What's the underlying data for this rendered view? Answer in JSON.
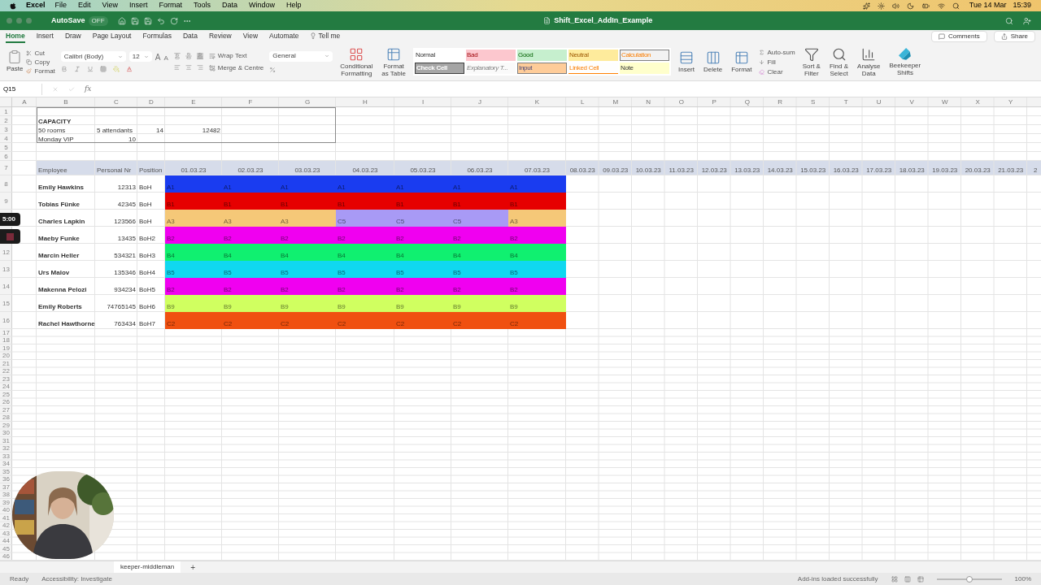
{
  "menu_bar": {
    "app": "Excel",
    "items": [
      "File",
      "Edit",
      "View",
      "Insert",
      "Format",
      "Tools",
      "Data",
      "Window",
      "Help"
    ],
    "date": "Tue 14 Mar",
    "time": "15:39"
  },
  "title_bar": {
    "autosave": "AutoSave",
    "autosave_state": "OFF",
    "title": "Shift_Excel_AddIn_Example"
  },
  "ribbon_tabs": [
    {
      "label": "Home",
      "selected": true
    },
    {
      "label": "Insert",
      "selected": false
    },
    {
      "label": "Draw",
      "selected": false
    },
    {
      "label": "Page Layout",
      "selected": false
    },
    {
      "label": "Formulas",
      "selected": false
    },
    {
      "label": "Data",
      "selected": false
    },
    {
      "label": "Review",
      "selected": false
    },
    {
      "label": "View",
      "selected": false
    },
    {
      "label": "Automate",
      "selected": false
    },
    {
      "label": "Tell me",
      "selected": false
    }
  ],
  "ribbon_actions": {
    "comments": "Comments",
    "share": "Share"
  },
  "ribbon": {
    "paste": "Paste",
    "cut": "Cut",
    "copy": "Copy",
    "format_painter": "Format",
    "font": "Calibri (Body)",
    "font_size": "12",
    "font_grow": "A",
    "font_shrink": "A",
    "wrap_text": "Wrap Text",
    "merge": "Merge & Centre",
    "number_format": "General",
    "conditional": [
      "Conditional",
      "Formatting"
    ],
    "format_table": [
      "Format",
      "as Table"
    ],
    "styles": [
      {
        "label": "Normal",
        "color": "#ffffff",
        "kind": "plain"
      },
      {
        "label": "Bad",
        "color": "#fcc7ce",
        "kind": "bad"
      },
      {
        "label": "Good",
        "color": "#c6efce",
        "kind": "good"
      },
      {
        "label": "Neutral",
        "color": "#feeb9c",
        "kind": "neutral"
      },
      {
        "label": "Calculation",
        "color": "#f2f2f2",
        "kind": "calc"
      },
      {
        "label": "Check Cell",
        "color": "#a5a5a5",
        "kind": "check"
      },
      {
        "label": "Explanatory T...",
        "color": "#fafafa",
        "kind": "explain"
      },
      {
        "label": "Input",
        "color": "#fecc99",
        "kind": "input"
      },
      {
        "label": "Linked Cell",
        "color": "#fefefe",
        "kind": "linked"
      },
      {
        "label": "Note",
        "color": "#ffffcc",
        "kind": "plain"
      }
    ],
    "cells_group": [
      "Insert",
      "Delete",
      "Format"
    ],
    "auto_sum": "Auto-sum",
    "fill": "Fill",
    "clear": "Clear",
    "sort": [
      "Sort &",
      "Filter"
    ],
    "find": [
      "Find &",
      "Select"
    ],
    "analyse": [
      "Analyse",
      "Data"
    ],
    "addin": [
      "Beekeeper",
      "Shifts"
    ]
  },
  "formula_bar": {
    "name_box": "Q15",
    "fx": "fx"
  },
  "sheet": {
    "columns": [
      "A",
      "B",
      "C",
      "D",
      "E",
      "F",
      "G",
      "H",
      "I",
      "J",
      "K",
      "L",
      "M",
      "N",
      "O",
      "P",
      "Q",
      "R",
      "S",
      "T",
      "U",
      "V",
      "W",
      "X",
      "Y"
    ],
    "top_rows": [
      "1",
      "2",
      "3",
      "4",
      "5",
      "6"
    ],
    "capacity": {
      "title": "CAPACITY",
      "rows": [
        [
          {
            "text": "50 rooms",
            "kind": "text"
          },
          {
            "text": "5 attendants",
            "kind": "text"
          },
          {
            "text": "14",
            "kind": "number"
          },
          {
            "text": "12482",
            "kind": "number"
          }
        ],
        [
          {
            "text": "Monday VIP",
            "kind": "text"
          },
          {
            "text": "10",
            "kind": "number"
          }
        ]
      ]
    },
    "header_row": {
      "number": "7",
      "labels": [
        "Employee",
        "Personal Nr",
        "Position"
      ],
      "dates": [
        "01.03.23",
        "02.03.23",
        "03.03.23",
        "04.03.23",
        "05.03.23",
        "06.03.23",
        "07.03.23",
        "08.03.23",
        "09.03.23",
        "10.03.23",
        "11.03.23",
        "12.03.23",
        "13.03.23",
        "14.03.23",
        "15.03.23",
        "16.03.23",
        "17.03.23",
        "18.03.23",
        "19.03.23",
        "20.03.23",
        "21.03.23",
        "2"
      ]
    },
    "employees": [
      {
        "number": "8",
        "name": "Emily Hawkins",
        "nr": "12313",
        "position": "BoH",
        "shifts": [
          {
            "code": "A1",
            "color": "#1a3cf0"
          },
          {
            "code": "A1",
            "color": "#1a3cf0"
          },
          {
            "code": "A1",
            "color": "#1a3cf0"
          },
          {
            "code": "A1",
            "color": "#1a3cf0"
          },
          {
            "code": "A1",
            "color": "#1a3cf0"
          },
          {
            "code": "A1",
            "color": "#1a3cf0"
          },
          {
            "code": "A1",
            "color": "#1a3cf0"
          }
        ]
      },
      {
        "number": "9",
        "name": "Tobias Fünke",
        "nr": "42345",
        "position": "BoH",
        "shifts": [
          {
            "code": "B1",
            "color": "#e60000"
          },
          {
            "code": "B1",
            "color": "#e60000"
          },
          {
            "code": "B1",
            "color": "#e60000"
          },
          {
            "code": "B1",
            "color": "#e60000"
          },
          {
            "code": "B1",
            "color": "#e60000"
          },
          {
            "code": "B1",
            "color": "#e60000"
          },
          {
            "code": "B1",
            "color": "#e60000"
          }
        ]
      },
      {
        "name": "Charles Lapkin",
        "nr": "123566",
        "position": "BoH",
        "shifts": [
          {
            "code": "A3",
            "color": "#f5c878"
          },
          {
            "code": "A3",
            "color": "#f5c878"
          },
          {
            "code": "A3",
            "color": "#f5c878"
          },
          {
            "code": "C5",
            "color": "#a89af5"
          },
          {
            "code": "C5",
            "color": "#a89af5"
          },
          {
            "code": "C5",
            "color": "#a89af5"
          },
          {
            "code": "A3",
            "color": "#f5c878"
          }
        ]
      },
      {
        "name": "Maeby Funke",
        "nr": "13435",
        "position": "BoH2",
        "shifts": [
          {
            "code": "B2",
            "color": "#f000f0"
          },
          {
            "code": "B2",
            "color": "#f000f0"
          },
          {
            "code": "B2",
            "color": "#f000f0"
          },
          {
            "code": "B2",
            "color": "#f000f0"
          },
          {
            "code": "B2",
            "color": "#f000f0"
          },
          {
            "code": "B2",
            "color": "#f000f0"
          },
          {
            "code": "B2",
            "color": "#f000f0"
          }
        ]
      },
      {
        "number": "12",
        "name": "Marcin Heller",
        "nr": "534321",
        "position": "BoH3",
        "shifts": [
          {
            "code": "B4",
            "color": "#10f070"
          },
          {
            "code": "B4",
            "color": "#10f070"
          },
          {
            "code": "B4",
            "color": "#10f070"
          },
          {
            "code": "B4",
            "color": "#10f070"
          },
          {
            "code": "B4",
            "color": "#10f070"
          },
          {
            "code": "B4",
            "color": "#10f070"
          },
          {
            "code": "B4",
            "color": "#10f070"
          }
        ]
      },
      {
        "number": "13",
        "name": "Urs Malov",
        "nr": "135346",
        "position": "BoH4",
        "shifts": [
          {
            "code": "B5",
            "color": "#10d8f0"
          },
          {
            "code": "B5",
            "color": "#10d8f0"
          },
          {
            "code": "B5",
            "color": "#10d8f0"
          },
          {
            "code": "B5",
            "color": "#10d8f0"
          },
          {
            "code": "B5",
            "color": "#10d8f0"
          },
          {
            "code": "B5",
            "color": "#10d8f0"
          },
          {
            "code": "B5",
            "color": "#10d8f0"
          }
        ]
      },
      {
        "number": "14",
        "name": "Makenna Pelozi",
        "nr": "934234",
        "position": "BoH5",
        "shifts": [
          {
            "code": "B2",
            "color": "#f000f0"
          },
          {
            "code": "B2",
            "color": "#f000f0"
          },
          {
            "code": "B2",
            "color": "#f000f0"
          },
          {
            "code": "B2",
            "color": "#f000f0"
          },
          {
            "code": "B2",
            "color": "#f000f0"
          },
          {
            "code": "B2",
            "color": "#f000f0"
          },
          {
            "code": "B2",
            "color": "#f000f0"
          }
        ]
      },
      {
        "number": "15",
        "name": "Emily Roberts",
        "nr": "74765145",
        "position": "BoH6",
        "shifts": [
          {
            "code": "B9",
            "color": "#d0ff60"
          },
          {
            "code": "B9",
            "color": "#d0ff60"
          },
          {
            "code": "B9",
            "color": "#d0ff60"
          },
          {
            "code": "B9",
            "color": "#d0ff60"
          },
          {
            "code": "B9",
            "color": "#d0ff60"
          },
          {
            "code": "B9",
            "color": "#d0ff60"
          },
          {
            "code": "B9",
            "color": "#d0ff60"
          }
        ]
      },
      {
        "number": "16",
        "name": "Rachel Hawthorne",
        "nr": "763434",
        "position": "BoH7",
        "shifts": [
          {
            "code": "C2",
            "color": "#f05010"
          },
          {
            "code": "C2",
            "color": "#f05010"
          },
          {
            "code": "C2",
            "color": "#f05010"
          },
          {
            "code": "C2",
            "color": "#f05010"
          },
          {
            "code": "C2",
            "color": "#f05010"
          },
          {
            "code": "C2",
            "color": "#f05010"
          },
          {
            "code": "C2",
            "color": "#f05010"
          }
        ]
      }
    ],
    "empty_rows": [
      "17",
      "18",
      "19",
      "20",
      "21",
      "22",
      "23",
      "24",
      "25",
      "26",
      "27",
      "28",
      "29",
      "30",
      "31",
      "32",
      "33",
      "34",
      "35",
      "36",
      "37",
      "38",
      "39",
      "40",
      "41",
      "42",
      "43",
      "44",
      "45",
      "46"
    ]
  },
  "sheet_tabs": [
    {
      "label": "keeper-middleman",
      "selected": true
    }
  ],
  "add_sheet": "+",
  "status_bar": {
    "state": "Ready",
    "accessibility": "Accessibility: Investigate",
    "addins": "Add-ins loaded successfully",
    "zoom": "100%",
    "zoom_slider": {
      "level": 0.5
    }
  },
  "recording": {
    "timer": "5:00"
  }
}
